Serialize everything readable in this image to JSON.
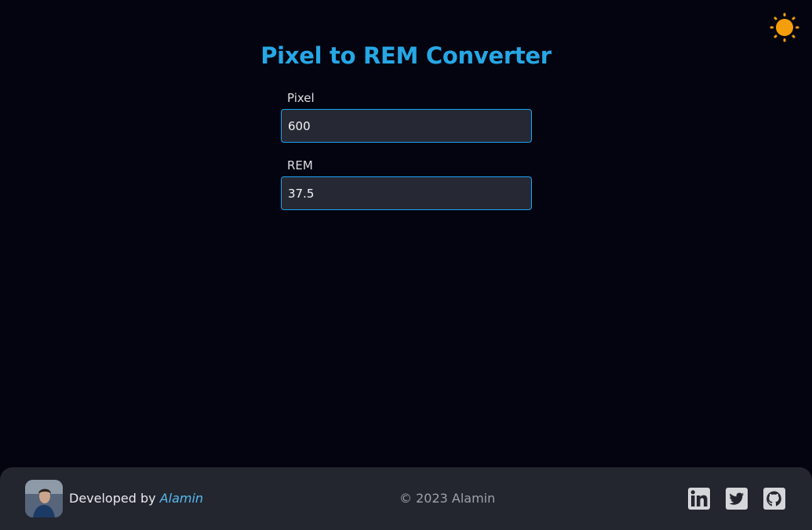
{
  "header": {
    "title": "Pixel to REM Converter",
    "theme_icon": "sun-icon"
  },
  "converter": {
    "pixel_label": "Pixel",
    "pixel_value": "600",
    "rem_label": "REM",
    "rem_value": "37.5"
  },
  "footer": {
    "developed_by": "Developed by",
    "developer_name": "Alamin",
    "copyright": "© 2023 Alamin",
    "social_icons": [
      "linkedin-icon",
      "twitter-icon",
      "github-icon"
    ]
  },
  "colors": {
    "background": "#03040f",
    "accent": "#26a7e6",
    "sun": "#f59e0b",
    "footer_bg": "#23262f",
    "input_bg": "#262934"
  }
}
